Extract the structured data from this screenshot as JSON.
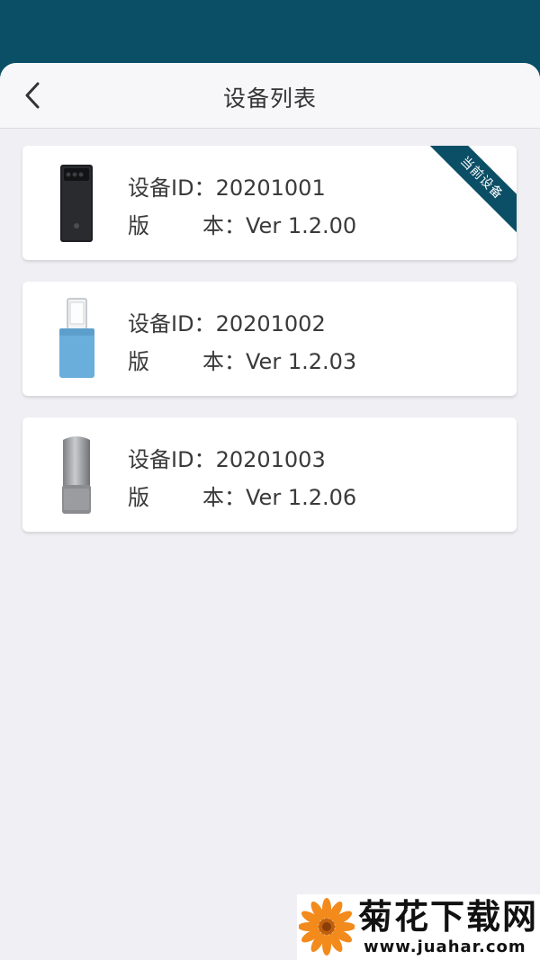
{
  "header": {
    "title": "设备列表",
    "back_icon": "chevron-left-icon"
  },
  "devices": [
    {
      "id_label": "设备ID：",
      "id_value": "20201001",
      "version_label": "版 本",
      "version_colon": "：",
      "version_value": "Ver 1.2.00",
      "image": "black-phone",
      "badge": "当前设备"
    },
    {
      "id_label": "设备ID：",
      "id_value": "20201002",
      "version_label": "版 本",
      "version_colon": "：",
      "version_value": "Ver 1.2.03",
      "image": "blue-usb-dongle"
    },
    {
      "id_label": "设备ID：",
      "id_value": "20201003",
      "version_label": "版 本",
      "version_colon": "：",
      "version_value": "Ver 1.2.06",
      "image": "silver-device"
    }
  ],
  "watermark": {
    "title": "菊花下载网",
    "url": "www.juahar.com"
  },
  "colors": {
    "brand": "#0b4f66",
    "background": "#efeff4",
    "card": "#ffffff",
    "text": "#3a3a3a"
  }
}
